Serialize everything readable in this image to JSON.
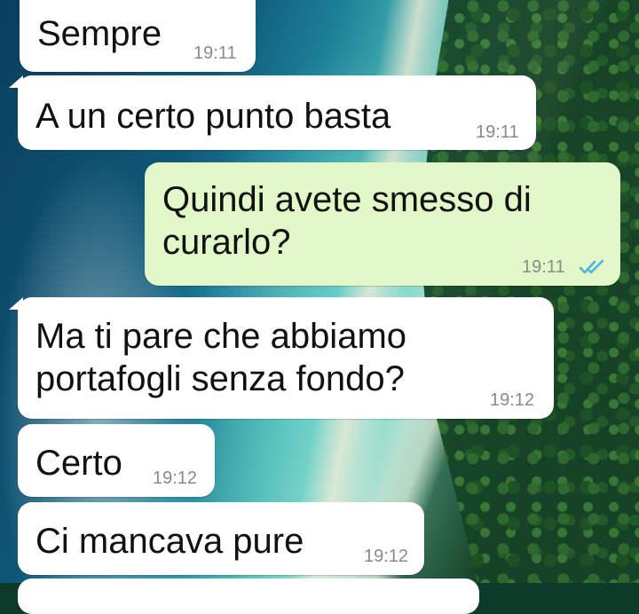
{
  "messages": [
    {
      "direction": "in",
      "text": "Sempre",
      "time": "19:11"
    },
    {
      "direction": "in",
      "text": "A un certo punto basta",
      "time": "19:11"
    },
    {
      "direction": "out",
      "text": "Quindi avete smesso di\ncurarlo?",
      "time": "19:11",
      "status": "read"
    },
    {
      "direction": "in",
      "text": "Ma ti pare che abbiamo\nportafogli senza fondo?",
      "time": "19:12"
    },
    {
      "direction": "in",
      "text": "Certo",
      "time": "19:12"
    },
    {
      "direction": "in",
      "text": "Ci mancava pure",
      "time": "19:12"
    }
  ],
  "colors": {
    "incoming_bubble": "#ffffff",
    "outgoing_bubble": "#e2f8c9",
    "timestamp": "#8a8a8a",
    "read_ticks": "#4fb3e0"
  },
  "icons": {
    "read_receipt": "double-check-icon"
  }
}
